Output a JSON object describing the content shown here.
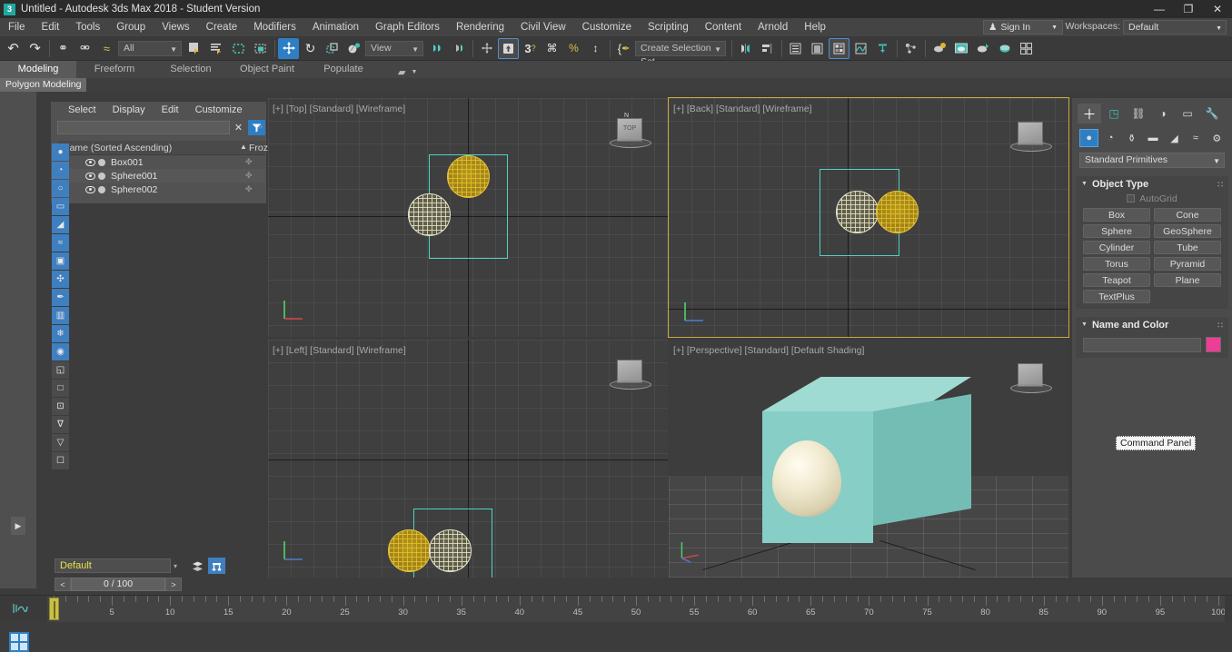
{
  "window": {
    "title": "Untitled - Autodesk 3ds Max 2018 - Student Version",
    "logo_text": "3",
    "minimize": "—",
    "maximize": "❐",
    "close": "✕"
  },
  "menubar": {
    "items": [
      "File",
      "Edit",
      "Tools",
      "Group",
      "Views",
      "Create",
      "Modifiers",
      "Animation",
      "Graph Editors",
      "Rendering",
      "Civil View",
      "Customize",
      "Scripting",
      "Content",
      "Arnold",
      "Help"
    ],
    "signin_label": "Sign In",
    "workspaces_label": "Workspaces:",
    "workspaces_value": "Default",
    "caret": "▼"
  },
  "toolbar": {
    "selection_filter": "All",
    "coordinate_system": "View",
    "selection_set": "Create Selection Set",
    "caret": "▼",
    "buttons": [
      {
        "name": "undo-button",
        "glyph": "↶"
      },
      {
        "name": "redo-button",
        "glyph": "↷"
      },
      {
        "name": "select-and-link-button",
        "glyph": "⚭"
      },
      {
        "name": "unlink-selection-button",
        "glyph": "⚮"
      },
      {
        "name": "bind-to-space-warp-button",
        "glyph": "≈"
      },
      {
        "name": "select-object-button",
        "glyph": "⬜"
      },
      {
        "name": "select-by-name-button",
        "glyph": "☰"
      },
      {
        "name": "rectangular-selection-region-button",
        "glyph": "⬚"
      },
      {
        "name": "window-crossing-toggle-button",
        "glyph": "▣"
      },
      {
        "name": "select-and-move-button",
        "glyph": "✥"
      },
      {
        "name": "select-and-rotate-button",
        "glyph": "↻"
      },
      {
        "name": "select-and-scale-button",
        "glyph": "◰"
      },
      {
        "name": "select-and-place-button",
        "glyph": "◔"
      },
      {
        "name": "use-pivot-point-center-button",
        "glyph": "⬡"
      },
      {
        "name": "use-selection-center-button",
        "glyph": "⬢"
      },
      {
        "name": "select-and-manipulate-button",
        "glyph": "✢"
      },
      {
        "name": "snaps-toggle-button",
        "glyph": "⬆"
      },
      {
        "name": "angle-snap-toggle-button",
        "glyph": "3"
      },
      {
        "name": "percent-snap-toggle-button",
        "glyph": "%"
      },
      {
        "name": "spinner-snap-toggle-button",
        "glyph": "↕"
      },
      {
        "name": "edit-named-selection-sets-button",
        "glyph": "{"
      },
      {
        "name": "mirror-button",
        "glyph": "◧"
      },
      {
        "name": "align-button",
        "glyph": "◫"
      },
      {
        "name": "layer-explorer-button",
        "glyph": "≡"
      },
      {
        "name": "scene-explorer-button",
        "glyph": "≣"
      },
      {
        "name": "material-editor-button",
        "glyph": "⊞"
      },
      {
        "name": "curve-editor-button",
        "glyph": "∼"
      },
      {
        "name": "schematic-view-button",
        "glyph": "⤒"
      },
      {
        "name": "particle-view-button",
        "glyph": "⚙"
      },
      {
        "name": "render-setup-button",
        "glyph": "◑"
      },
      {
        "name": "rendered-frame-window-button",
        "glyph": "▤"
      },
      {
        "name": "render-production-button",
        "glyph": "◕"
      },
      {
        "name": "render-iterative-button",
        "glyph": "◔"
      },
      {
        "name": "quad-render-button",
        "glyph": "⊟"
      }
    ]
  },
  "ribbon": {
    "tabs": [
      {
        "label": "Modeling",
        "active": true
      },
      {
        "label": "Freeform",
        "active": false
      },
      {
        "label": "Selection",
        "active": false
      },
      {
        "label": "Object Paint",
        "active": false
      },
      {
        "label": "Populate",
        "active": false
      }
    ],
    "panel_label": "Polygon Modeling"
  },
  "explorer": {
    "menus": [
      "Select",
      "Display",
      "Edit",
      "Customize"
    ],
    "search_value": "",
    "search_placeholder": "",
    "clear_icon": "✕",
    "filter_icon": "▼",
    "lock_icon": "⚿",
    "chevron": "»",
    "col_name": "Name (Sorted Ascending)",
    "col_sort_arrow": "▲",
    "col_frozen": "Frozen",
    "rows": [
      {
        "name": "Box001",
        "frozen": "✤"
      },
      {
        "name": "Sphere001",
        "frozen": "✤"
      },
      {
        "name": "Sphere002",
        "frozen": "✤"
      }
    ],
    "tool_column": [
      {
        "name": "filter-geometry-icon",
        "glyph": "●",
        "on": true
      },
      {
        "name": "filter-shapes-icon",
        "glyph": "◔",
        "on": true
      },
      {
        "name": "filter-lights-icon",
        "glyph": "○",
        "on": true
      },
      {
        "name": "filter-cameras-icon",
        "glyph": "▭",
        "on": true
      },
      {
        "name": "filter-helpers-icon",
        "glyph": "◢",
        "on": true
      },
      {
        "name": "filter-space-warps-icon",
        "glyph": "≈",
        "on": true
      },
      {
        "name": "filter-groups-icon",
        "glyph": "▣",
        "on": true
      },
      {
        "name": "filter-xrefs-icon",
        "glyph": "✣",
        "on": true
      },
      {
        "name": "filter-bones-icon",
        "glyph": "✒",
        "on": true
      },
      {
        "name": "filter-particles-icon",
        "glyph": "▥",
        "on": true
      },
      {
        "name": "filter-frozen-icon",
        "glyph": "❄",
        "on": true
      },
      {
        "name": "filter-hidden-icon",
        "glyph": "◉",
        "on": true
      },
      {
        "name": "display-layers-icon",
        "glyph": "◱",
        "on": false
      },
      {
        "name": "display-containers-icon",
        "glyph": "□",
        "on": false
      },
      {
        "name": "display-materials-icon",
        "glyph": "⊡",
        "on": false
      },
      {
        "name": "filter-remove-icon",
        "glyph": "∇",
        "on": false
      },
      {
        "name": "filter-funnel-icon",
        "glyph": "▽",
        "on": false
      },
      {
        "name": "folder-icon",
        "glyph": "☐",
        "on": false
      }
    ]
  },
  "left_strip": {
    "expand_arrow": "▶"
  },
  "viewports": [
    {
      "name": "viewport-top",
      "label": "[+] [Top] [Standard] [Wireframe]",
      "active": false,
      "view": "top"
    },
    {
      "name": "viewport-back",
      "label": "[+] [Back] [Standard] [Wireframe]",
      "active": true,
      "view": "back"
    },
    {
      "name": "viewport-left",
      "label": "[+] [Left] [Standard] [Wireframe]",
      "active": false,
      "view": "left"
    },
    {
      "name": "viewport-perspective",
      "label": "[+] [Perspective] [Standard] [Default Shading]",
      "active": false,
      "view": "perspective"
    }
  ],
  "viewcube": {
    "face_label": "TOP",
    "north_label": "N"
  },
  "command_panel": {
    "tabs": [
      {
        "name": "create-tab",
        "glyph": "＋",
        "active": true
      },
      {
        "name": "modify-tab",
        "glyph": "◳",
        "active": false
      },
      {
        "name": "hierarchy-tab",
        "glyph": "⛓",
        "active": false
      },
      {
        "name": "motion-tab",
        "glyph": "◑",
        "active": false
      },
      {
        "name": "display-tab",
        "glyph": "▭",
        "active": false
      },
      {
        "name": "utilities-tab",
        "glyph": "🔧",
        "active": false
      }
    ],
    "subtabs": [
      {
        "name": "geometry-button",
        "glyph": "●",
        "on": true
      },
      {
        "name": "shapes-button",
        "glyph": "◔",
        "on": false
      },
      {
        "name": "lights-button",
        "glyph": "⚱",
        "on": false
      },
      {
        "name": "cameras-button",
        "glyph": "▬",
        "on": false
      },
      {
        "name": "helpers-button",
        "glyph": "◢",
        "on": false
      },
      {
        "name": "space-warps-button",
        "glyph": "≈",
        "on": false
      },
      {
        "name": "systems-button",
        "glyph": "⚙",
        "on": false
      }
    ],
    "category": "Standard Primitives",
    "caret": "▼",
    "object_type": {
      "title": "Object Type",
      "triangle": "▼",
      "grip": "∷",
      "autogrid_label": "AutoGrid",
      "buttons": [
        "Box",
        "Cone",
        "Sphere",
        "GeoSphere",
        "Cylinder",
        "Tube",
        "Torus",
        "Pyramid",
        "Teapot",
        "Plane",
        "TextPlus"
      ]
    },
    "name_and_color": {
      "title": "Name and Color",
      "triangle": "▼",
      "grip": "∷",
      "name_value": "",
      "color_hex": "#ee3d96"
    }
  },
  "tooltip": {
    "text": "Command Panel"
  },
  "bottom": {
    "layer_value": "Default",
    "layer_caret": "▾",
    "layer_buttons": [
      {
        "name": "layer-manager-button",
        "glyph": "≣",
        "on": false
      },
      {
        "name": "isolate-selection-button",
        "glyph": "⛶",
        "on": true
      }
    ],
    "frame_prev": "<",
    "frame_next": ">",
    "frame_value": "0 / 100",
    "curve_icon": "∿"
  },
  "timeline": {
    "start": 0,
    "end": 100,
    "major_step": 5,
    "labels": [
      5,
      10,
      15,
      20,
      25,
      30,
      35,
      40,
      45,
      50,
      55,
      60,
      65,
      70,
      75,
      80,
      85,
      90,
      95,
      100
    ],
    "slider_frame": 0
  },
  "colors": {
    "accent_blue": "#2e7ec4",
    "selected_gold": "#e8c23a",
    "wireframe_teal": "#4fd3c4",
    "cube_teal": "#87cec6",
    "swatch_magenta": "#ee3d96",
    "layer_text_yellow": "#e8e04a"
  }
}
